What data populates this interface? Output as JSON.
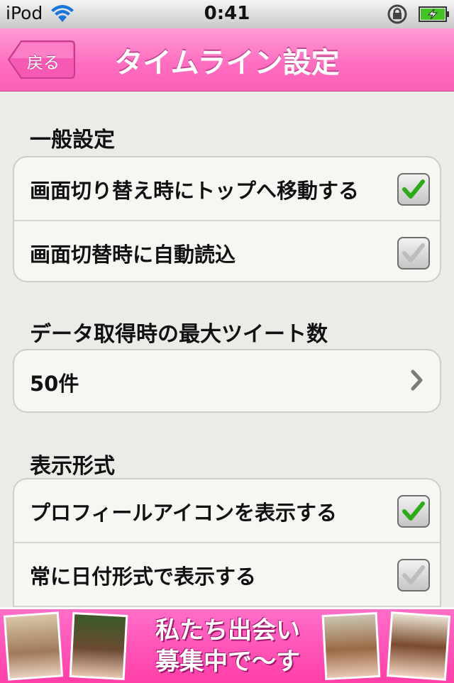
{
  "status_bar": {
    "carrier": "iPod",
    "time": "0:41"
  },
  "nav": {
    "back_label": "戻る",
    "title": "タイムライン設定",
    "color": "#ff6fc0"
  },
  "sections": {
    "general": {
      "header": "一般設定",
      "rows": [
        {
          "label": "画面切り替え時にトップへ移動する",
          "checked": true
        },
        {
          "label": "画面切替時に自動読込",
          "checked": false
        }
      ]
    },
    "max_tweets": {
      "header": "データ取得時の最大ツイート数",
      "value": "50件"
    },
    "display": {
      "header": "表示形式",
      "rows": [
        {
          "label": "プロフィールアイコンを表示する",
          "checked": true
        },
        {
          "label": "常に日付形式で表示する",
          "checked": false
        }
      ]
    }
  },
  "banner": {
    "line1": "私たち出会い",
    "line2": "募集中で～す"
  },
  "colors": {
    "check_green": "#2faa1a",
    "check_gray": "#b8b8b8"
  }
}
